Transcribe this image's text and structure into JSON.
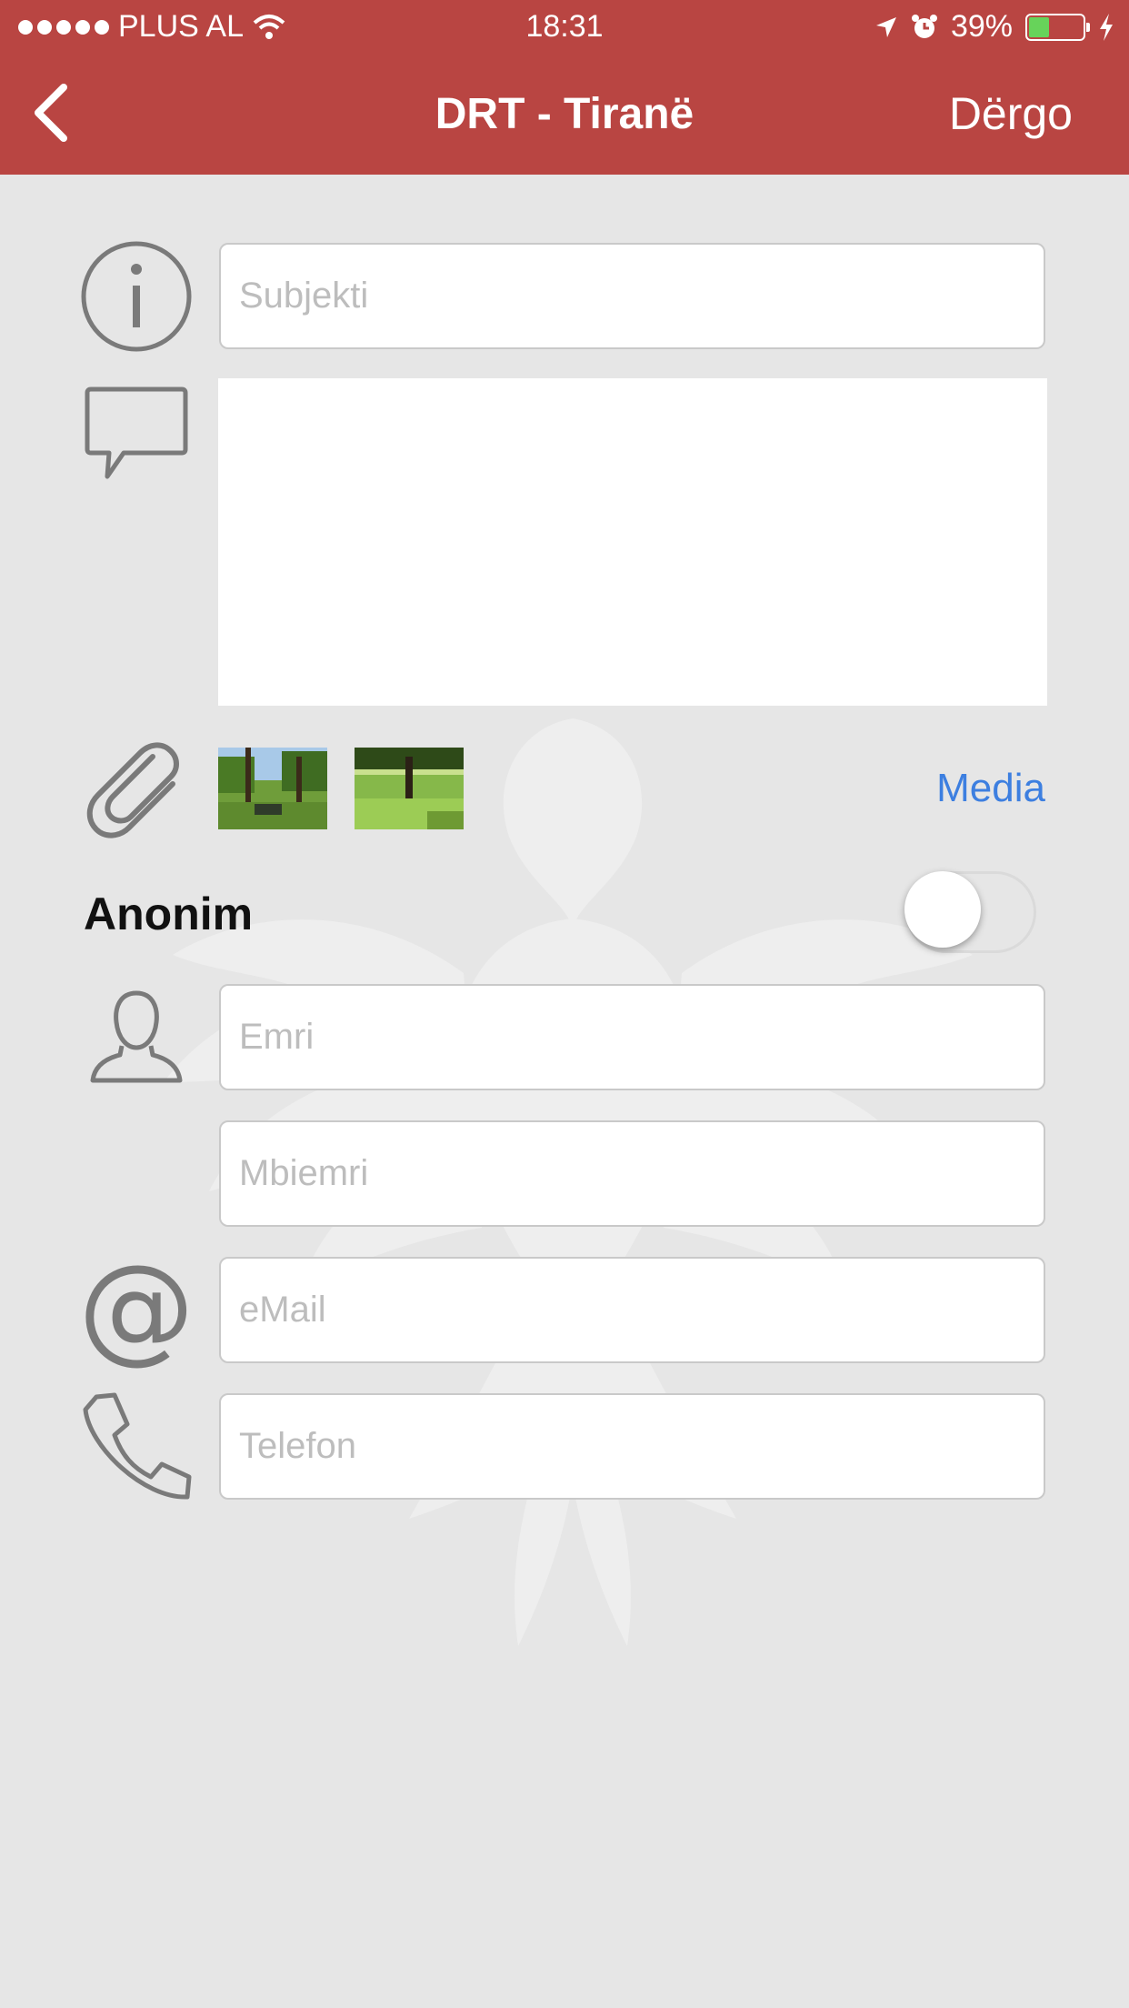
{
  "status_bar": {
    "carrier": "PLUS AL",
    "time": "18:31",
    "battery": "39%",
    "icons": [
      "signal-dots-icon",
      "wifi-icon",
      "location-arrow-icon",
      "alarm-icon",
      "battery-icon",
      "charging-bolt-icon"
    ]
  },
  "nav": {
    "title": "DRT - Tiranë",
    "send_label": "Dërgo",
    "back_icon": "chevron-left-icon"
  },
  "form": {
    "subject_placeholder": "Subjekti",
    "message_value": "",
    "attachments_label": "Media",
    "attachments_count": 2,
    "anonymous_label": "Anonim",
    "anonymous_on": false,
    "first_name_placeholder": "Emri",
    "last_name_placeholder": "Mbiemri",
    "email_placeholder": "eMail",
    "phone_placeholder": "Telefon"
  },
  "colors": {
    "header": "#b94542",
    "background": "#e6e6e6",
    "link": "#3d7fe0"
  }
}
